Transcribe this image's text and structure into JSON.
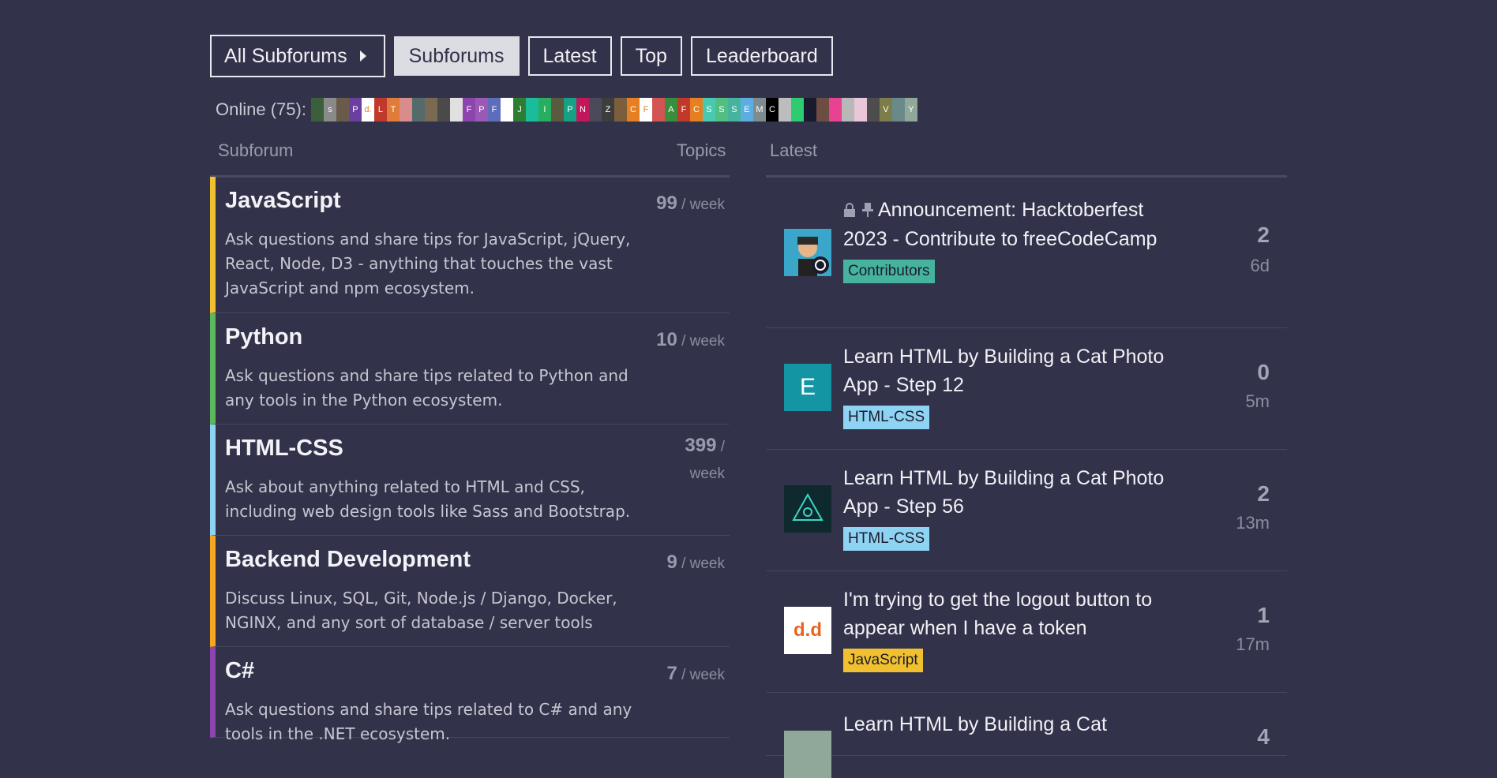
{
  "nav": {
    "all_label": "All Subforums",
    "tabs": [
      "Subforums",
      "Latest",
      "Top",
      "Leaderboard"
    ]
  },
  "online": {
    "label": "Online (75):",
    "avatars": [
      {
        "t": "",
        "c": "#3b5f3b"
      },
      {
        "t": "s",
        "c": "#8a8a8a"
      },
      {
        "t": "",
        "c": "#6a5a4a"
      },
      {
        "t": "P",
        "c": "#6b3fa0"
      },
      {
        "t": "d.",
        "c": "#ffffff"
      },
      {
        "t": "L",
        "c": "#c0392b"
      },
      {
        "t": "T",
        "c": "#e07b39"
      },
      {
        "t": "",
        "c": "#d98c8c"
      },
      {
        "t": "",
        "c": "#556b6b"
      },
      {
        "t": "",
        "c": "#7a6a52"
      },
      {
        "t": "",
        "c": "#4a4a4a"
      },
      {
        "t": "",
        "c": "#e0e0e0"
      },
      {
        "t": "F",
        "c": "#8e44ad"
      },
      {
        "t": "P",
        "c": "#9b59b6"
      },
      {
        "t": "F",
        "c": "#5d6dbb"
      },
      {
        "t": "",
        "c": "#ffffff"
      },
      {
        "t": "J",
        "c": "#2e7d32"
      },
      {
        "t": "",
        "c": "#1abc9c"
      },
      {
        "t": "I",
        "c": "#27ae60"
      },
      {
        "t": "",
        "c": "#5a5a40"
      },
      {
        "t": "P",
        "c": "#16a085"
      },
      {
        "t": "N",
        "c": "#c2185b"
      },
      {
        "t": "",
        "c": "#4a4a5a"
      },
      {
        "t": "Z",
        "c": "#3d3d3d"
      },
      {
        "t": "",
        "c": "#7b5e3b"
      },
      {
        "t": "C",
        "c": "#e67e22"
      },
      {
        "t": "F",
        "c": "#ffffff"
      },
      {
        "t": "",
        "c": "#d35454"
      },
      {
        "t": "A",
        "c": "#388e3c"
      },
      {
        "t": "F",
        "c": "#c0392b"
      },
      {
        "t": "C",
        "c": "#e67e22"
      },
      {
        "t": "S",
        "c": "#48c9b0"
      },
      {
        "t": "S",
        "c": "#52be80"
      },
      {
        "t": "S",
        "c": "#45b39d"
      },
      {
        "t": "E",
        "c": "#5dade2"
      },
      {
        "t": "M",
        "c": "#7f8c8d"
      },
      {
        "t": "C",
        "c": "#000000"
      },
      {
        "t": "",
        "c": "#bdbdbd"
      },
      {
        "t": "",
        "c": "#2ecc71"
      },
      {
        "t": "",
        "c": "#1a1a2e"
      },
      {
        "t": "",
        "c": "#6d4c41"
      },
      {
        "t": "",
        "c": "#e84393"
      },
      {
        "t": "",
        "c": "#b8b8b8"
      },
      {
        "t": "",
        "c": "#e9c6d8"
      },
      {
        "t": "",
        "c": "#4d4d4d"
      },
      {
        "t": "V",
        "c": "#7d7d4a"
      },
      {
        "t": "",
        "c": "#6a8a8a"
      },
      {
        "t": "Y",
        "c": "#8fa89a"
      }
    ]
  },
  "headers": {
    "subforum": "Subforum",
    "topics": "Topics",
    "latest": "Latest"
  },
  "categories": [
    {
      "name": "JavaScript",
      "desc": "Ask questions and share tips for JavaScript, jQuery, React, Node, D3 - anything that touches the vast JavaScript and npm ecosystem.",
      "count": "99",
      "unit": " / week",
      "color": "#f0c030"
    },
    {
      "name": "Python",
      "desc": "Ask questions and share tips related to Python and any tools in the Python ecosystem.",
      "count": "10",
      "unit": " / week",
      "color": "#5cb85c"
    },
    {
      "name": "HTML-CSS",
      "desc": "Ask about anything related to HTML and CSS, including web design tools like Sass and Bootstrap.",
      "count": "399",
      "unit": " / week",
      "color": "#8fd3f4"
    },
    {
      "name": "Backend Development",
      "desc": "Discuss Linux, SQL, Git, Node.js / Django, Docker, NGINX, and any sort of database / server tools",
      "count": "9",
      "unit": " / week",
      "color": "#f5a623"
    },
    {
      "name": "C#",
      "desc": "Ask questions and share tips related to C# and any tools in the .NET ecosystem.",
      "count": "7",
      "unit": " / week",
      "color": "#8e44ad"
    }
  ],
  "topics": [
    {
      "title": "Announcement: Hacktoberfest 2023 - Contribute to freeCodeCamp",
      "badge": "Contributors",
      "badge_color": "#45b39d",
      "posts": "2",
      "age": "6d",
      "avatar": "",
      "avatar_bg": "#3aa6c9",
      "locked": true,
      "pinned": true
    },
    {
      "title": "Learn HTML by Building a Cat Photo App - Step 12",
      "badge": "HTML-CSS",
      "badge_color": "#8fd3f4",
      "posts": "0",
      "age": "5m",
      "avatar": "E",
      "avatar_bg": "#1495a3",
      "locked": false,
      "pinned": false
    },
    {
      "title": "Learn HTML by Building a Cat Photo App - Step 56",
      "badge": "HTML-CSS",
      "badge_color": "#8fd3f4",
      "posts": "2",
      "age": "13m",
      "avatar": "",
      "avatar_bg": "#0e2a2e",
      "locked": false,
      "pinned": false
    },
    {
      "title": "I'm trying to get the logout button to appear when I have a token",
      "badge": "JavaScript",
      "badge_color": "#f0c030",
      "posts": "1",
      "age": "17m",
      "avatar": "d.d",
      "avatar_bg": "#ffffff",
      "locked": false,
      "pinned": false
    },
    {
      "title": "Learn HTML by Building a Cat",
      "badge": "",
      "badge_color": "#8fd3f4",
      "posts": "4",
      "age": "",
      "avatar": "",
      "avatar_bg": "#8fa89a",
      "locked": false,
      "pinned": false
    }
  ]
}
